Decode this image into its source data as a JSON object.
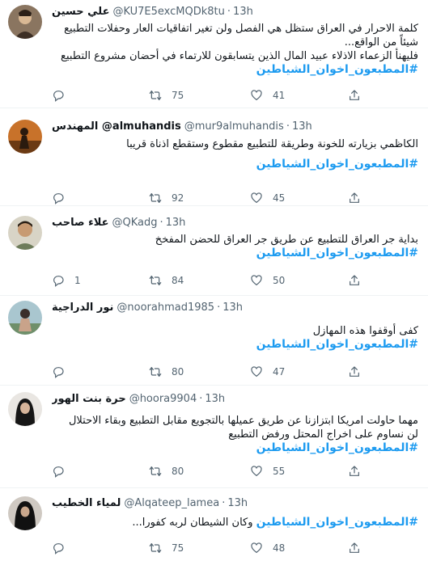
{
  "tweets": [
    {
      "name": "علي حسين",
      "handle": "@KU7E5excMQDk8tu",
      "time": "13h",
      "lines": [
        "كلمة الاحرار في العراق ستظل هي الفصل ولن تغير اتفاقيات العار وحفلات التطبيع",
        "شيئاً من الواقع...",
        "فليهنأ الزعماء الاذلاء عبيد المال الذين يتسابقون للارتماء في أحضان مشروع التطبيع"
      ],
      "hashtag": "#المطبعون_اخوان_الشياطين",
      "replies": "",
      "retweets": "75",
      "likes": "41"
    },
    {
      "name": "المهندس @almuhandis",
      "handle": "@mur9almuhandis",
      "time": "13h",
      "lines": [
        "الكاظمي بزيارته للخونة وطريقة للتطبيع مقطوع وستقطع اذناة قريبا"
      ],
      "hashtag": "#المطبعون_اخوان_الشياطين",
      "replies": "",
      "retweets": "92",
      "likes": "45"
    },
    {
      "name": "علاء صاحب",
      "handle": "@QKadg",
      "time": "13h",
      "lines": [
        "بداية جر العراق للتطبيع عن طريق جر العراق للحضن المفخخ"
      ],
      "hashtag": "#المطبعون_اخوان_الشياطين",
      "replies": "1",
      "retweets": "84",
      "likes": "50"
    },
    {
      "name": "نور الدراجية",
      "handle": "@noorahmad1985",
      "time": "13h",
      "lines": [
        "كفى أوقفوا هذه المهازل"
      ],
      "hashtag": "#المطبعون_اخوان_الشياطين",
      "replies": "",
      "retweets": "80",
      "likes": "47"
    },
    {
      "name": "حرة بنت الهور",
      "handle": "@hoora9904",
      "time": "13h",
      "lines": [
        "مهما حاولت امريكا ابتزازنا عن طريق عميلها بالتجويع مقابل التطبيع وبقاء الاحتلال",
        "لن نساوم على اخراج المحتل ورفض التطبيع"
      ],
      "hashtag": "#المطبعون_اخوان_الشياطين",
      "replies": "",
      "retweets": "80",
      "likes": "55"
    },
    {
      "name": "لمياء الخطيب",
      "handle": "@Alqateep_lamea",
      "time": "13h",
      "lines": [],
      "inline_text": "وكان الشيطان لربه كفورا...",
      "hashtag": "#المطبعون_اخوان_الشياطين",
      "replies": "",
      "retweets": "75",
      "likes": "48"
    }
  ],
  "icons": {
    "reply": "reply-icon",
    "retweet": "retweet-icon",
    "like": "heart-icon",
    "share": "share-icon"
  },
  "colors": {
    "hashtag": "#1d9bf0",
    "muted": "#536471",
    "text": "#0f1419"
  }
}
